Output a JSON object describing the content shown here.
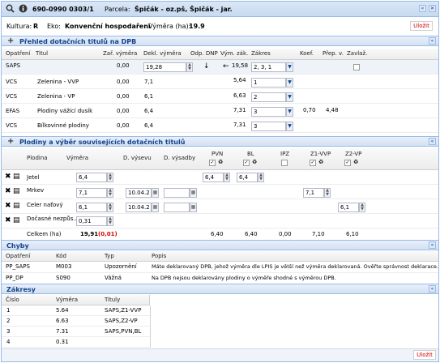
{
  "top": {
    "ident": "690-0990 0303/1",
    "parcel_label": "Parcela:",
    "parcel_value": "Špičák - oz.pš, Špičák - jar."
  },
  "info": {
    "kultura_label": "Kultura:",
    "kultura_value": "R",
    "eko_label": "Eko:",
    "eko_value": "Konvenční hospodaření",
    "vymera_label": "Výměra (ha):",
    "vymera_value": "19.9",
    "ulozit": "Uložit"
  },
  "dpb": {
    "title": "Přehled dotačních titulů na DPB",
    "headers": [
      "Opatření",
      "Titul",
      "Zař. výměra",
      "Dekl. výměra",
      "Odp. DNP",
      "Vým. zák.",
      "Zákres",
      "Koef.",
      "Přep. v.",
      "Zavlaž."
    ],
    "rows": [
      {
        "opatreni": "SAPS",
        "titul": "",
        "zar": "0,00",
        "dekl": "19,28",
        "vym": "19,58",
        "zakres": "2, 3, 1",
        "koef": "",
        "prep": ""
      },
      {
        "opatreni": "VCS",
        "titul": "Zelenina - VVP",
        "zar": "0,00",
        "dekl": "7,1",
        "vym": "5,64",
        "zakres": "1",
        "koef": "",
        "prep": ""
      },
      {
        "opatreni": "VCS",
        "titul": "Zelenina - VP",
        "zar": "0,00",
        "dekl": "6,1",
        "vym": "6,63",
        "zakres": "2",
        "koef": "",
        "prep": ""
      },
      {
        "opatreni": "EFAS",
        "titul": "Plodiny vážící dusík",
        "zar": "0,00",
        "dekl": "6,4",
        "vym": "7,31",
        "zakres": "3",
        "koef": "0,70",
        "prep": "4,48"
      },
      {
        "opatreni": "VCS",
        "titul": "Bílkovinné plodiny",
        "zar": "0,00",
        "dekl": "6,4",
        "vym": "7,31",
        "zakres": "3",
        "koef": "",
        "prep": ""
      }
    ]
  },
  "plodiny": {
    "title": "Plodiny a výběr souvisejících dotačních titulů",
    "headers": {
      "plodina": "Plodina",
      "vymera": "Výměra",
      "vysev": "D. výsevu",
      "vysadba": "D. výsadby",
      "pvn": "PVN",
      "bl": "BL",
      "ipz": "IPZ",
      "z1": "Z1-VVP",
      "z2": "Z2-VP"
    },
    "rows": [
      {
        "name": "Jetel",
        "vymera": "6,4",
        "vysev": "",
        "vysadba": "",
        "pvn": "6,4",
        "bl": "6,4",
        "z1": "",
        "z2": ""
      },
      {
        "name": "Mrkev",
        "vymera": "7,1",
        "vysev": "10.04.2",
        "vysadba": "",
        "pvn": "",
        "bl": "",
        "z1": "7,1",
        "z2": ""
      },
      {
        "name": "Celer naťový",
        "vymera": "6,1",
        "vysev": "10.04.2",
        "vysadba": "",
        "pvn": "",
        "bl": "",
        "z1": "",
        "z2": "6,1"
      },
      {
        "name": "Dočasné nezpůs...",
        "vymera": "0,31",
        "vysev": "",
        "vysadba": "",
        "pvn": "",
        "bl": "",
        "z1": "",
        "z2": ""
      }
    ],
    "total": {
      "label": "Celkem (ha)",
      "vymera": "19,91",
      "diff": "(0,01)",
      "pvn": "6,40",
      "bl": "6,40",
      "ipz": "0,00",
      "z1": "7,10",
      "z2": "6,10"
    }
  },
  "chyby": {
    "title": "Chyby",
    "headers": [
      "Opatření",
      "Kód",
      "Typ",
      "Popis"
    ],
    "rows": [
      {
        "op": "PP_SAPS",
        "kod": "M003",
        "typ": "Upozornění",
        "popis": "Máte deklarovaný DPB, jehož výměra dle LPIS je větší než výměra deklarovaná. Ověřte správnost deklarace."
      },
      {
        "op": "PP_DP",
        "kod": "S090",
        "typ": "Vážná",
        "popis": "Na DPB nejsou deklarovány plodiny o výměře shodné s výměrou DPB."
      }
    ]
  },
  "zakresy": {
    "title": "Zákresy",
    "headers": [
      "Číslo",
      "Výměra",
      "Tituly"
    ],
    "rows": [
      {
        "cislo": "1",
        "vymera": "5.64",
        "tituly": "SAPS,Z1-VVP"
      },
      {
        "cislo": "2",
        "vymera": "6.63",
        "tituly": "SAPS,Z2-VP"
      },
      {
        "cislo": "3",
        "vymera": "7.31",
        "tituly": "SAPS,PVN,BL"
      },
      {
        "cislo": "4",
        "vymera": "0.31",
        "tituly": ""
      }
    ]
  },
  "bottom": {
    "ulozit": "Uložit"
  },
  "colors": {
    "header_blue": "#15428b",
    "border_blue": "#99bbe8",
    "error_red": "#cc0000"
  },
  "icons": [
    "search-icon",
    "info-icon",
    "collapse-icon",
    "close-icon",
    "plus-icon",
    "delete-icon",
    "edit-icon",
    "calendar-icon",
    "checkbox-icon",
    "refresh-icon"
  ]
}
